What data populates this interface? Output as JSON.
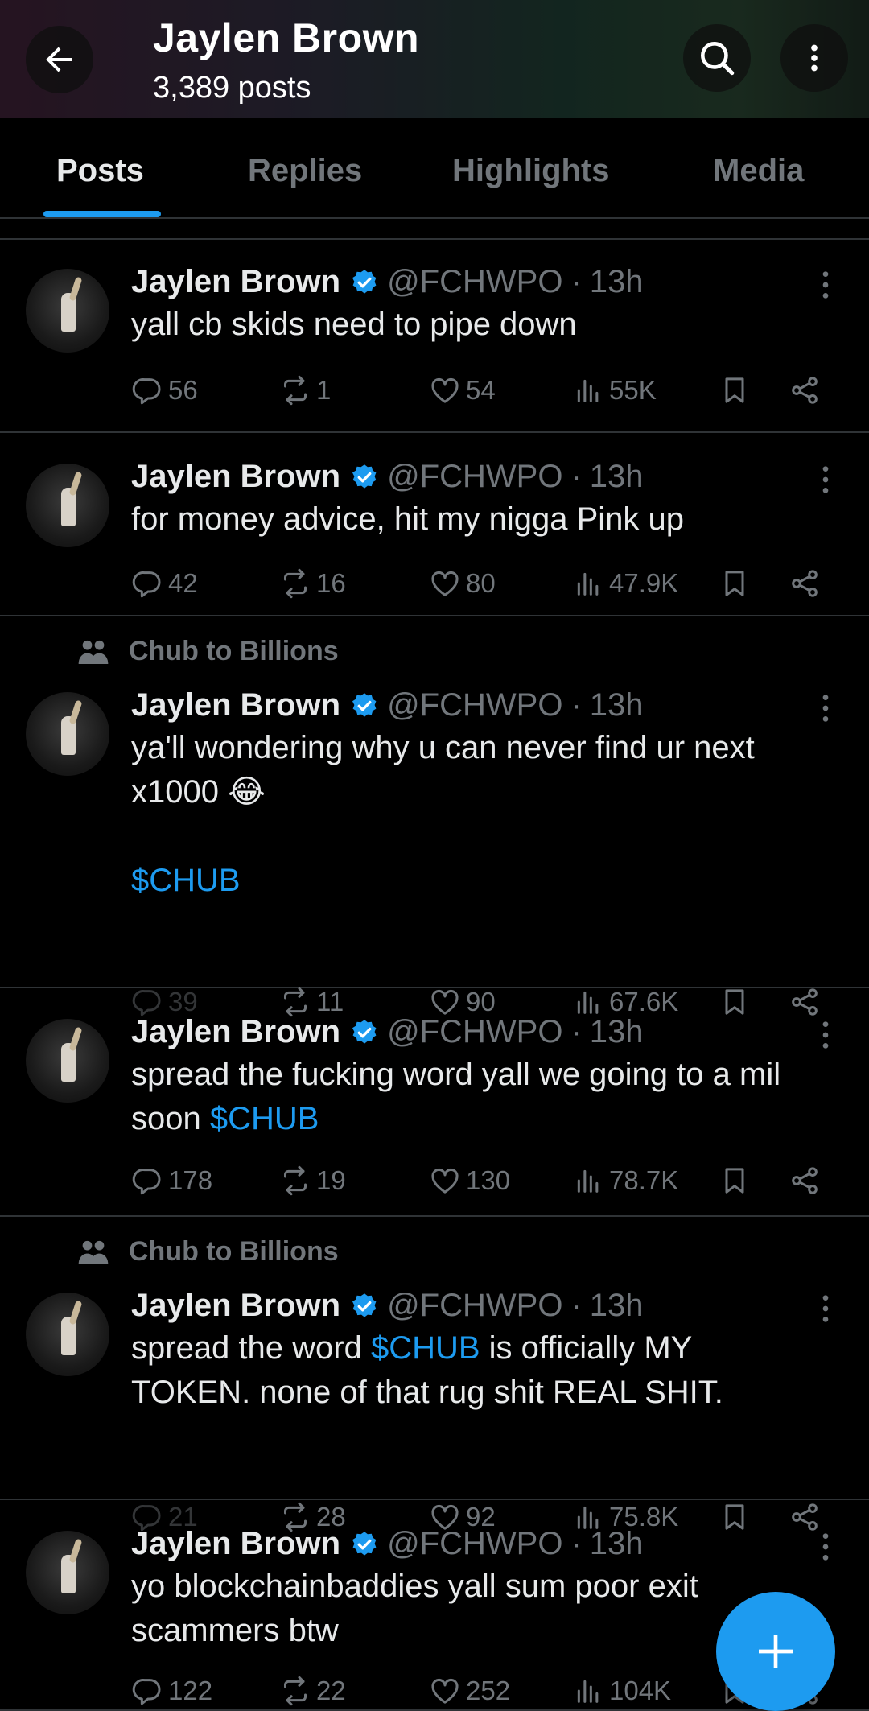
{
  "header": {
    "title": "Jaylen Brown",
    "post_count": "3,389 posts"
  },
  "tabs": [
    {
      "label": "Posts",
      "active": true
    },
    {
      "label": "Replies",
      "active": false
    },
    {
      "label": "Highlights",
      "active": false
    },
    {
      "label": "Media",
      "active": false
    }
  ],
  "accent_color": "#1d9bf0",
  "posts": [
    {
      "context": "",
      "author": "Jaylen Brown",
      "handle": "@FCHWPO",
      "separator": "·",
      "time": "13h",
      "text_parts": [
        "yall cb skids need to pipe down"
      ],
      "replies": "56",
      "reposts": "1",
      "likes": "54",
      "views": "55K"
    },
    {
      "context": "",
      "author": "Jaylen Brown",
      "handle": "@FCHWPO",
      "separator": "·",
      "time": "13h",
      "text_parts": [
        "for money advice, hit my nigga Pink up"
      ],
      "replies": "42",
      "reposts": "16",
      "likes": "80",
      "views": "47.9K"
    },
    {
      "context": "Chub to Billions",
      "author": "Jaylen Brown",
      "handle": "@FCHWPO",
      "separator": "·",
      "time": "13h",
      "text_parts": [
        "ya'll wondering why u can never find ur next",
        "x1000 😂",
        "$CHUB"
      ],
      "replies": "39",
      "reposts": "11",
      "likes": "90",
      "views": "67.6K"
    },
    {
      "context": "",
      "author": "Jaylen Brown",
      "handle": "@FCHWPO",
      "separator": "·",
      "time": "13h",
      "text_parts": [
        "spread the fucking word yall we going to a mil",
        "soon ",
        "$CHUB"
      ],
      "replies": "178",
      "reposts": "19",
      "likes": "130",
      "views": "78.7K"
    },
    {
      "context": "Chub to Billions",
      "author": "Jaylen Brown",
      "handle": "@FCHWPO",
      "separator": "·",
      "time": "13h",
      "text_parts": [
        "spread the word ",
        "$CHUB",
        " is officially MY",
        "TOKEN. none of that rug shit REAL SHIT."
      ],
      "replies": "21",
      "reposts": "28",
      "likes": "92",
      "views": "75.8K"
    },
    {
      "context": "",
      "author": "Jaylen Brown",
      "handle": "@FCHWPO",
      "separator": "·",
      "time": "13h",
      "text_parts": [
        "yo blockchainbaddies yall sum poor exit",
        "scammers btw"
      ],
      "replies": "122",
      "reposts": "22",
      "likes": "252",
      "views": "104K"
    }
  ]
}
